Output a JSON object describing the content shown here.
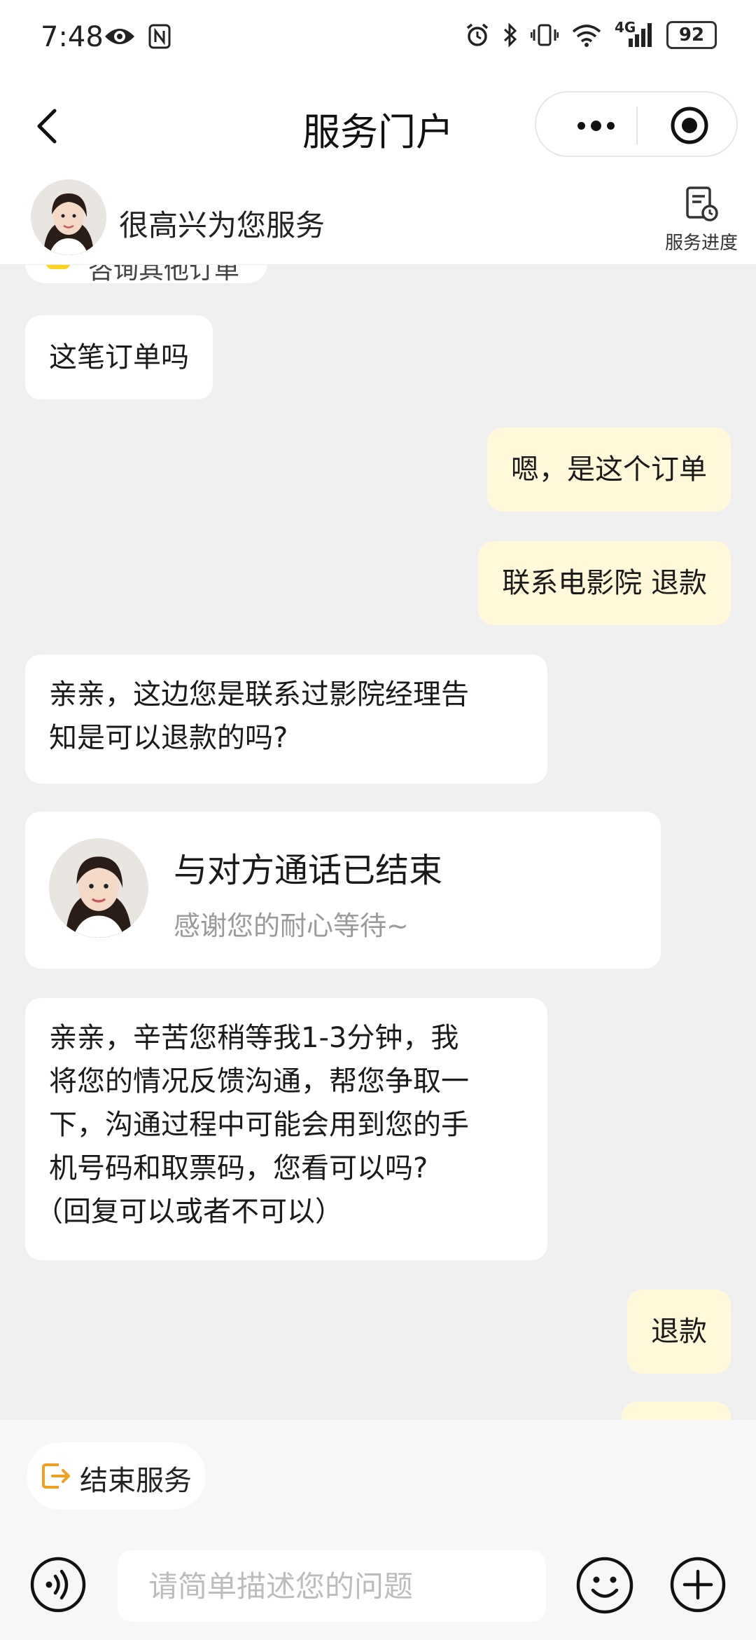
{
  "status_bar": {
    "time": "7:48",
    "battery": "92",
    "network": "4G",
    "left_icons": [
      "eye-icon",
      "nfc-icon"
    ],
    "right_icons": [
      "alarm-icon",
      "bluetooth-icon",
      "vibrate-icon",
      "wifi-icon",
      "signal-icon",
      "battery-icon"
    ]
  },
  "nav": {
    "title": "服务门户"
  },
  "agent": {
    "greeting": "很高兴为您服务",
    "progress_label": "服务进度"
  },
  "chat": {
    "cut_chip_text": "咨询其他订单",
    "messages": [
      {
        "from": "agent",
        "text": "这笔订单吗"
      },
      {
        "from": "user",
        "text": "嗯，是这个订单"
      },
      {
        "from": "user",
        "text": "联系电影院 退款"
      },
      {
        "from": "agent",
        "lines": [
          "亲亲，这边您是联系过影院经理告",
          "知是可以退款的吗?"
        ]
      },
      {
        "from": "agent",
        "lines": [
          "亲亲，辛苦您稍等我1-3分钟，我",
          "将您的情况反馈沟通，帮您争取一",
          "下，沟通过程中可能会用到您的手",
          "机号码和取票码，您看可以吗?",
          "（回复可以或者不可以）"
        ]
      },
      {
        "from": "user",
        "text": "退款"
      }
    ],
    "call_card": {
      "title": "与对方通话已结束",
      "subtitle": "感谢您的耐心等待~"
    }
  },
  "footer": {
    "end_service_label": "结束服务",
    "input_placeholder": "请简单描述您的问题"
  },
  "colors": {
    "user_bubble": "#fff9d9",
    "agent_bubble": "#ffffff",
    "background": "#efefef",
    "accent": "#f0a020"
  }
}
